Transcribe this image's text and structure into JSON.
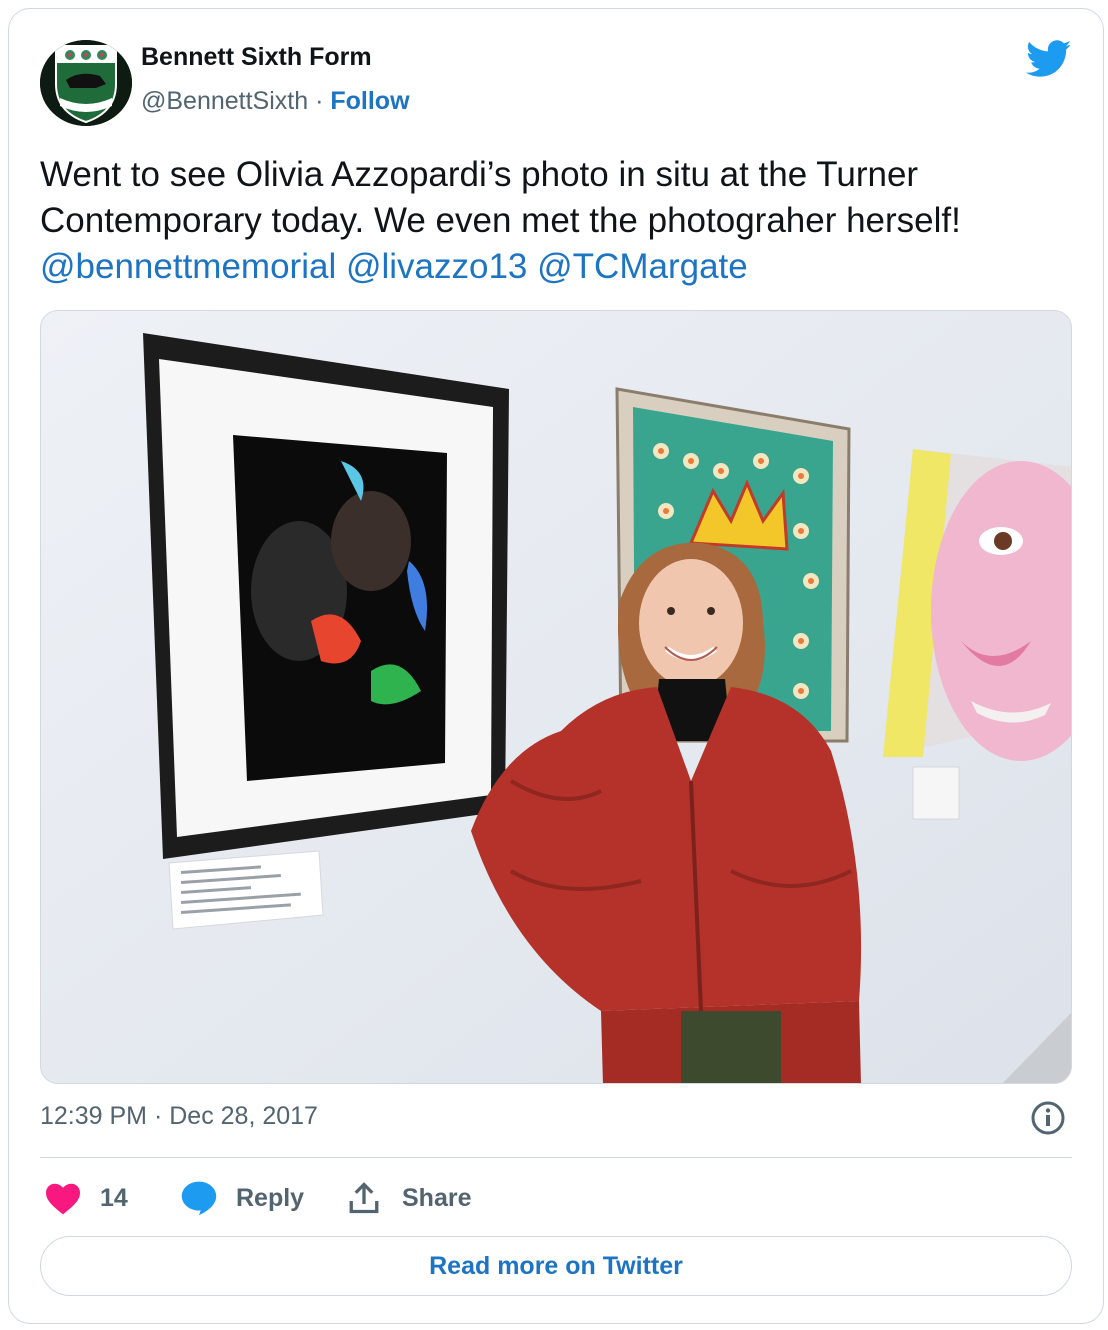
{
  "author": {
    "name": "Bennett Sixth Form",
    "handle": "@BennettSixth",
    "separator": " · ",
    "follow_label": "Follow"
  },
  "tweet": {
    "text_line_1": "Went to see Olivia Azzopardi’s photo in situ at the Turner",
    "text_line_2": "Contemporary today. We even met the photograher herself!",
    "mentions": [
      "@bennettmemorial",
      "@livazzo13",
      "@TCMargate"
    ]
  },
  "meta": {
    "time": "12:39 PM",
    "separator": " · ",
    "date": "Dec 28, 2017"
  },
  "actions": {
    "like_count": "14",
    "reply_label": "Reply",
    "share_label": "Share"
  },
  "read_more_label": "Read more on Twitter",
  "icons": {
    "brand": "twitter-bird-icon",
    "info": "info-icon",
    "like": "heart-icon",
    "reply": "reply-bubble-icon",
    "share": "share-upload-icon"
  },
  "colors": {
    "link": "#1d74c2",
    "twitter_blue": "#1d9bf0",
    "like_pink": "#f91880",
    "muted": "#536471",
    "border": "#cfd9de"
  }
}
